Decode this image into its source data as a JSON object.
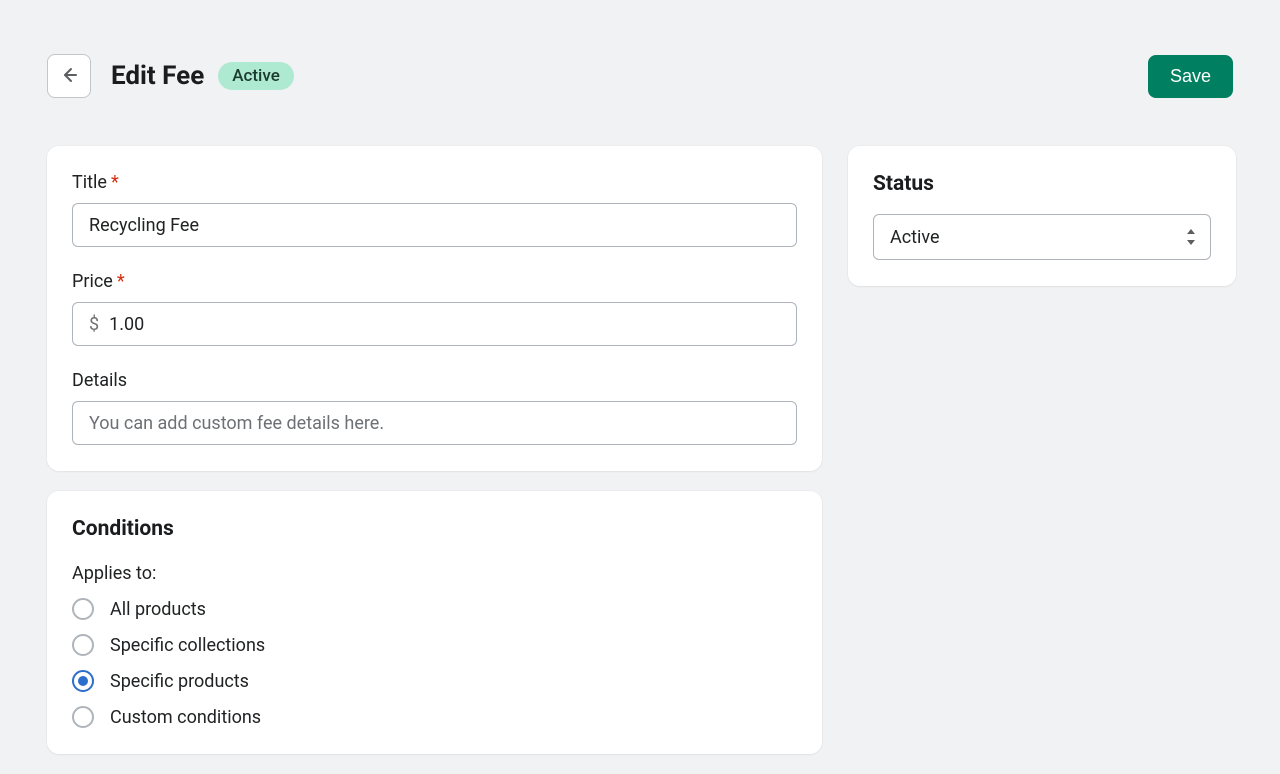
{
  "header": {
    "title": "Edit Fee",
    "badge": "Active",
    "save_label": "Save"
  },
  "form": {
    "title_label": "Title",
    "title_value": "Recycling Fee",
    "price_label": "Price",
    "price_prefix": "$",
    "price_value": "1.00",
    "details_label": "Details",
    "details_placeholder": "You can add custom fee details here.",
    "details_value": ""
  },
  "conditions": {
    "heading": "Conditions",
    "applies_label": "Applies to:",
    "options": [
      {
        "label": "All products",
        "selected": false
      },
      {
        "label": "Specific collections",
        "selected": false
      },
      {
        "label": "Specific products",
        "selected": true
      },
      {
        "label": "Custom conditions",
        "selected": false
      }
    ]
  },
  "status": {
    "heading": "Status",
    "value": "Active"
  }
}
